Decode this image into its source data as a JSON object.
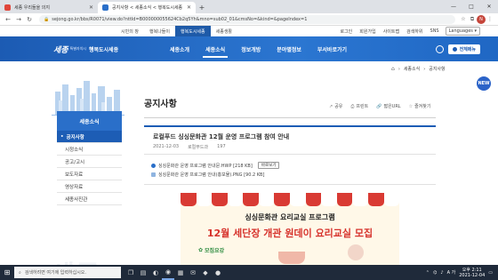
{
  "browser": {
    "tabs": [
      {
        "title": "세종 우리들을 의지",
        "active": false,
        "favicon_color": "#e0463a"
      },
      {
        "title": "공지사항 < 세종소식 < 행복도시세종",
        "active": true,
        "favicon_color": "#2a6fc9"
      }
    ],
    "new_tab": "+",
    "url": "sejong.go.kr/bbs/R0071/view.do?nttId=B000000055624Cb2q5Yh&mno=sub02_01&cmsNo=&kind=&pageIndex=1",
    "profile_initial": "N",
    "win_controls": [
      "—",
      "□",
      "✕"
    ]
  },
  "utility_nav": {
    "left": [
      {
        "label": "시민의 창",
        "active": false
      },
      {
        "label": "행복나들이",
        "active": false
      },
      {
        "label": "행복도시세종",
        "active": true
      },
      {
        "label": "세종생활",
        "active": false
      }
    ],
    "right": [
      "로그인",
      "회원가입",
      "사이트맵",
      "검색하위",
      "SNS"
    ],
    "language": "Languages ▾"
  },
  "main_nav": {
    "logo_mark": "세종",
    "logo_sub": "특별자치시",
    "logo_slogan": "행복도시세종",
    "items": [
      {
        "label": "세종소개",
        "active": false
      },
      {
        "label": "세종소식",
        "active": true
      },
      {
        "label": "정보개방",
        "active": false
      },
      {
        "label": "분야별정보",
        "active": false
      },
      {
        "label": "부서바로가기",
        "active": false
      }
    ],
    "all_menu_label": "전체메뉴"
  },
  "breadcrumb": [
    "⌂",
    "세종소식",
    "공지사항"
  ],
  "sidebar": {
    "title": "세종소식",
    "items": [
      {
        "label": "공지사항",
        "active": true
      },
      {
        "label": "시정소식",
        "active": false
      },
      {
        "label": "공고/고시",
        "active": false
      },
      {
        "label": "보도자료",
        "active": false
      },
      {
        "label": "영상자료",
        "active": false
      },
      {
        "label": "세종사진관",
        "active": false
      }
    ]
  },
  "page": {
    "title": "공지사항",
    "toolbar": [
      {
        "icon": "share-icon",
        "glyph": "↗",
        "label": "공유"
      },
      {
        "icon": "print-icon",
        "glyph": "⎙",
        "label": "프린트"
      },
      {
        "icon": "link-icon",
        "glyph": "🔗",
        "label": "짧은URL"
      },
      {
        "icon": "star-icon",
        "glyph": "☆",
        "label": "즐겨찾기"
      }
    ]
  },
  "post": {
    "title": "로컬푸드 싱싱문화관 12월 운영 프로그램 참여 안내",
    "date": "2021-12-03",
    "author": "로컬푸드과",
    "views": "197",
    "attachments": [
      {
        "name": "싱싱문화관 운영 프로그램 안내문.HWP [218 KB]",
        "preview": "바로보기"
      },
      {
        "name": "싱싱문화관 운영 프로그램 안내(홍보물).PNG [90.2 KB]",
        "preview": ""
      }
    ]
  },
  "poster": {
    "line1": "싱싱문화관 요리교실 프로그램",
    "line2": "12월 세단장 개관 원데이 요리교실 모집",
    "recruit": "모집요강"
  },
  "floating": {
    "label": "NEW"
  },
  "taskbar": {
    "search_placeholder": "검색하려면 여기에 입력하십시오.",
    "lang": "A 가",
    "time": "오후 2:11",
    "date": "2021-12-04"
  },
  "decor": {
    "big_text": "세종"
  }
}
